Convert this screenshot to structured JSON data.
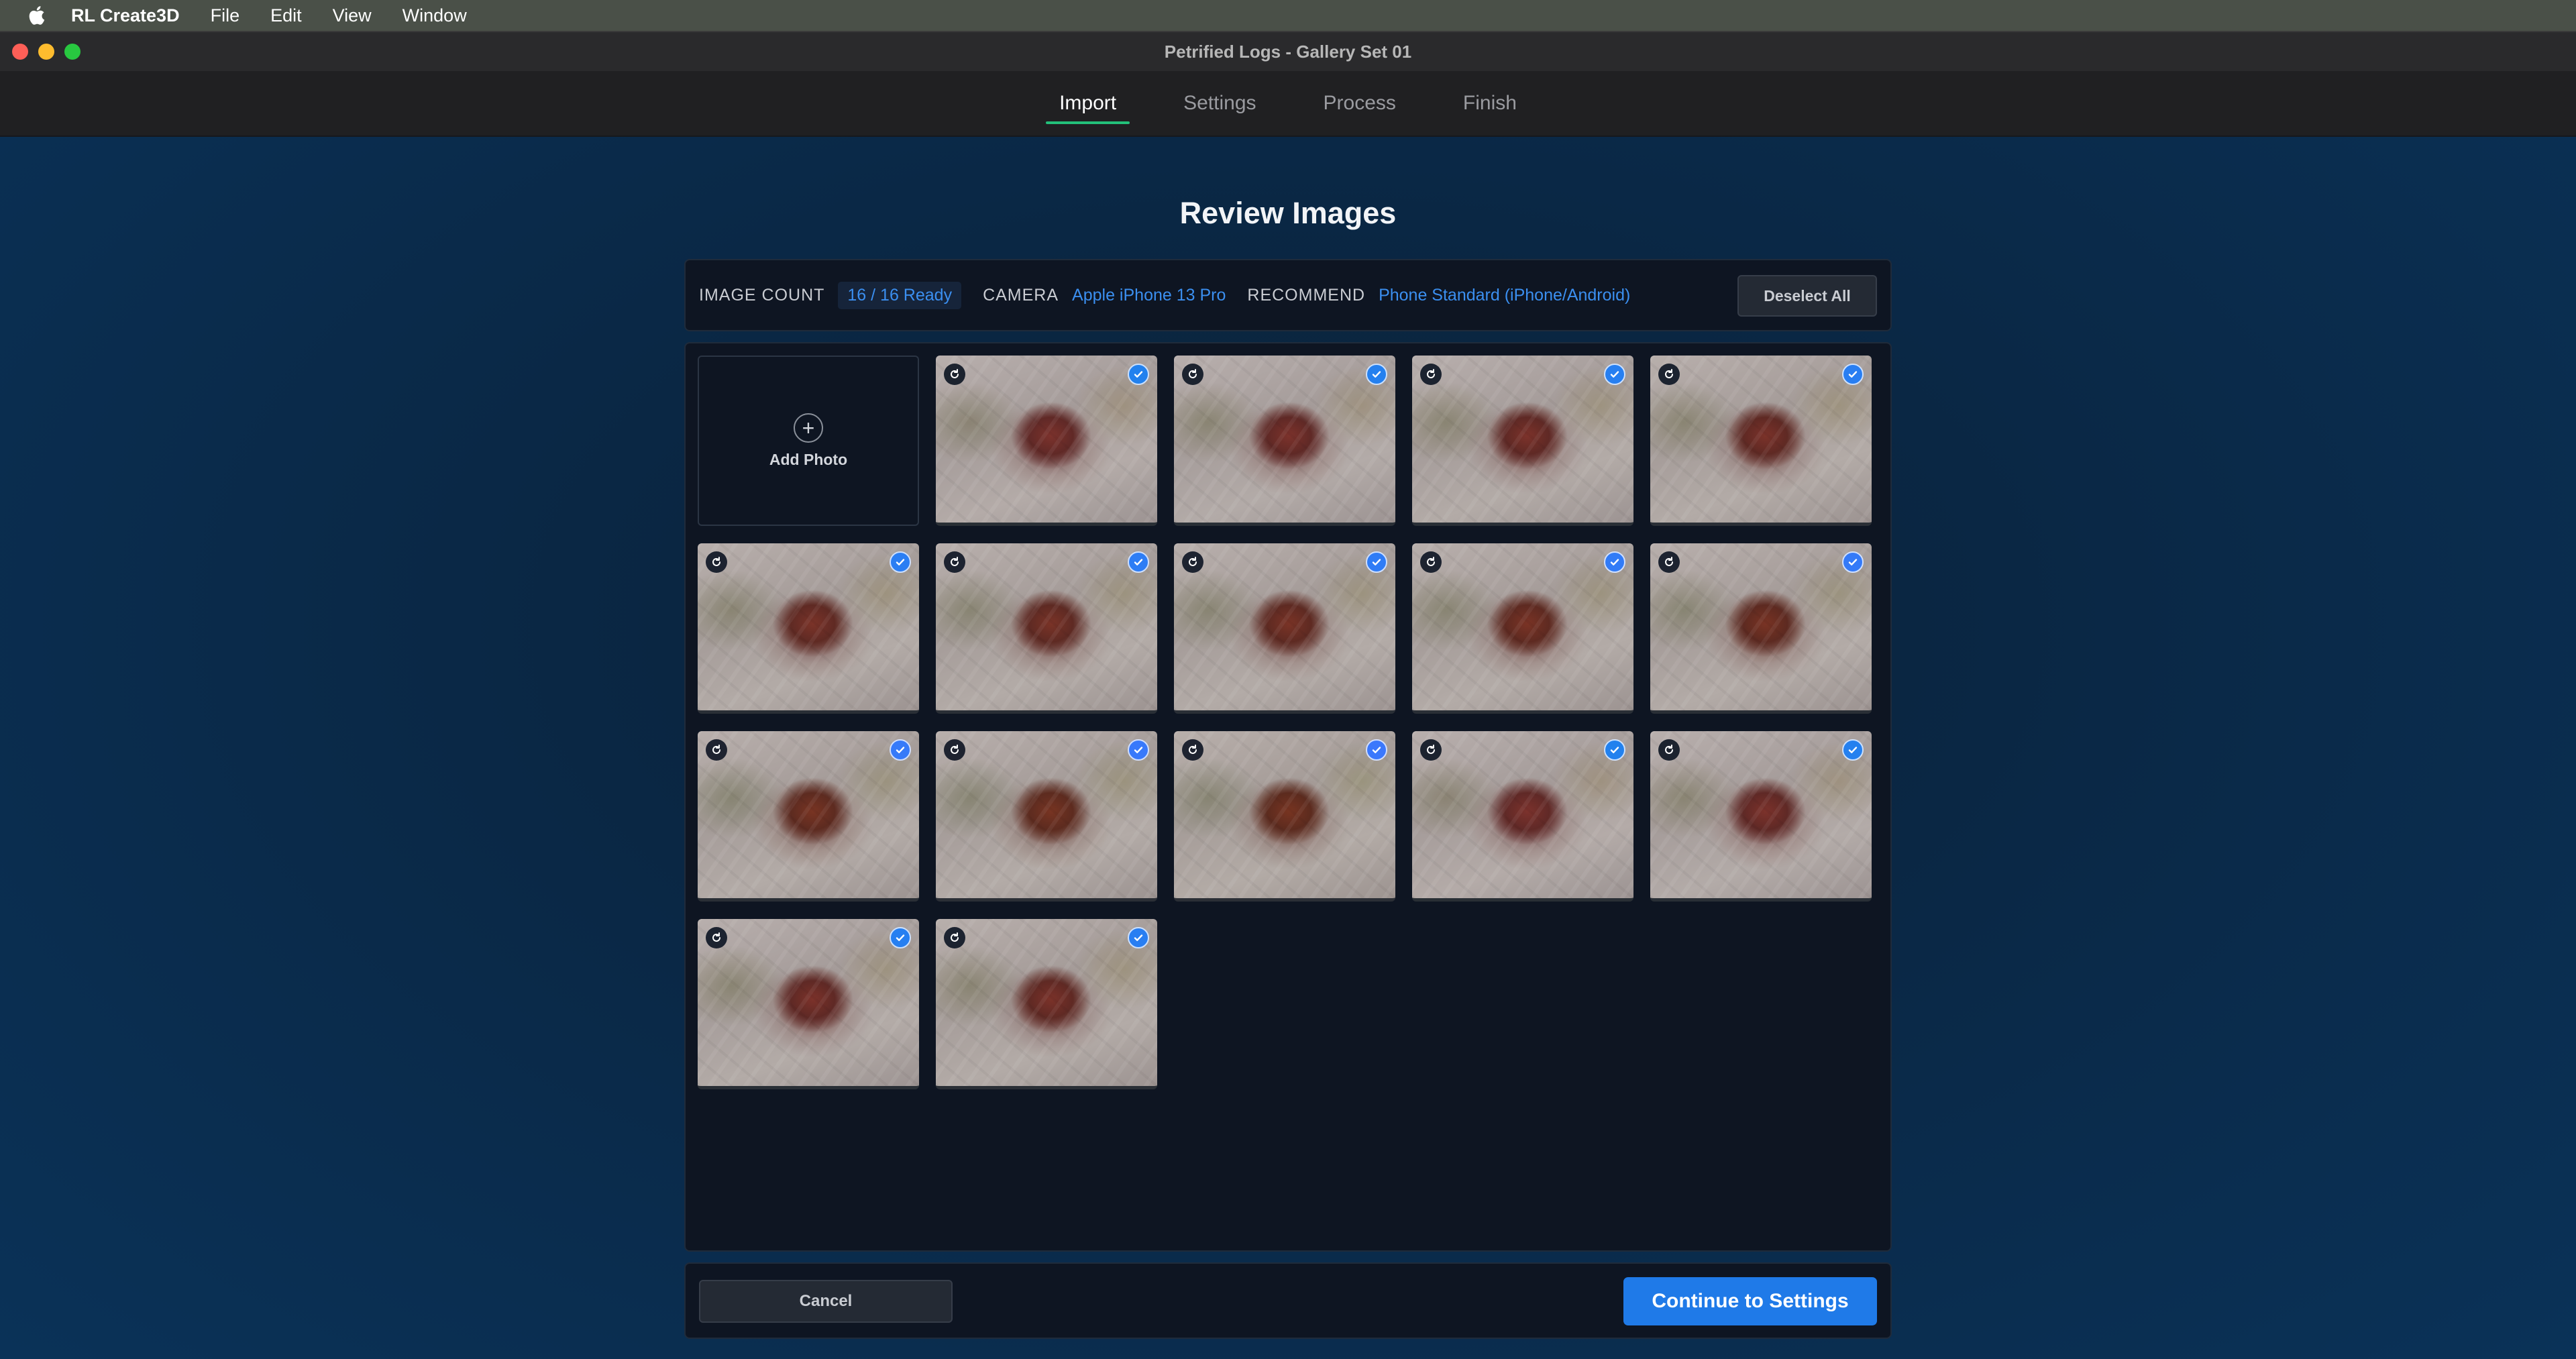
{
  "menubar": {
    "app_name": "RL Create3D",
    "items": [
      "File",
      "Edit",
      "View",
      "Window"
    ]
  },
  "window": {
    "title": "Petrified Logs - Gallery Set 01"
  },
  "tabs": [
    {
      "label": "Import",
      "active": true
    },
    {
      "label": "Settings",
      "active": false
    },
    {
      "label": "Process",
      "active": false
    },
    {
      "label": "Finish",
      "active": false
    }
  ],
  "page": {
    "title": "Review Images"
  },
  "info": {
    "image_count_label": "IMAGE COUNT",
    "image_count_value": "16 / 16 Ready",
    "camera_label": "CAMERA",
    "camera_value": "Apple iPhone 13 Pro",
    "recommend_label": "RECOMMEND",
    "recommend_value": "Phone Standard (iPhone/Android)",
    "deselect_label": "Deselect All"
  },
  "grid": {
    "add_photo_label": "Add Photo",
    "add_photo_icon": "+",
    "thumbnails": [
      {
        "selected": true
      },
      {
        "selected": true
      },
      {
        "selected": true
      },
      {
        "selected": true
      },
      {
        "selected": true
      },
      {
        "selected": true
      },
      {
        "selected": true
      },
      {
        "selected": true
      },
      {
        "selected": true
      },
      {
        "selected": true
      },
      {
        "selected": true
      },
      {
        "selected": true
      },
      {
        "selected": true
      },
      {
        "selected": true
      },
      {
        "selected": true
      },
      {
        "selected": true
      }
    ]
  },
  "footer": {
    "cancel_label": "Cancel",
    "continue_label": "Continue to Settings"
  },
  "colors": {
    "accent": "#1f7ae8",
    "tab_underline": "#23c07a",
    "info_value": "#3b8ff0"
  }
}
